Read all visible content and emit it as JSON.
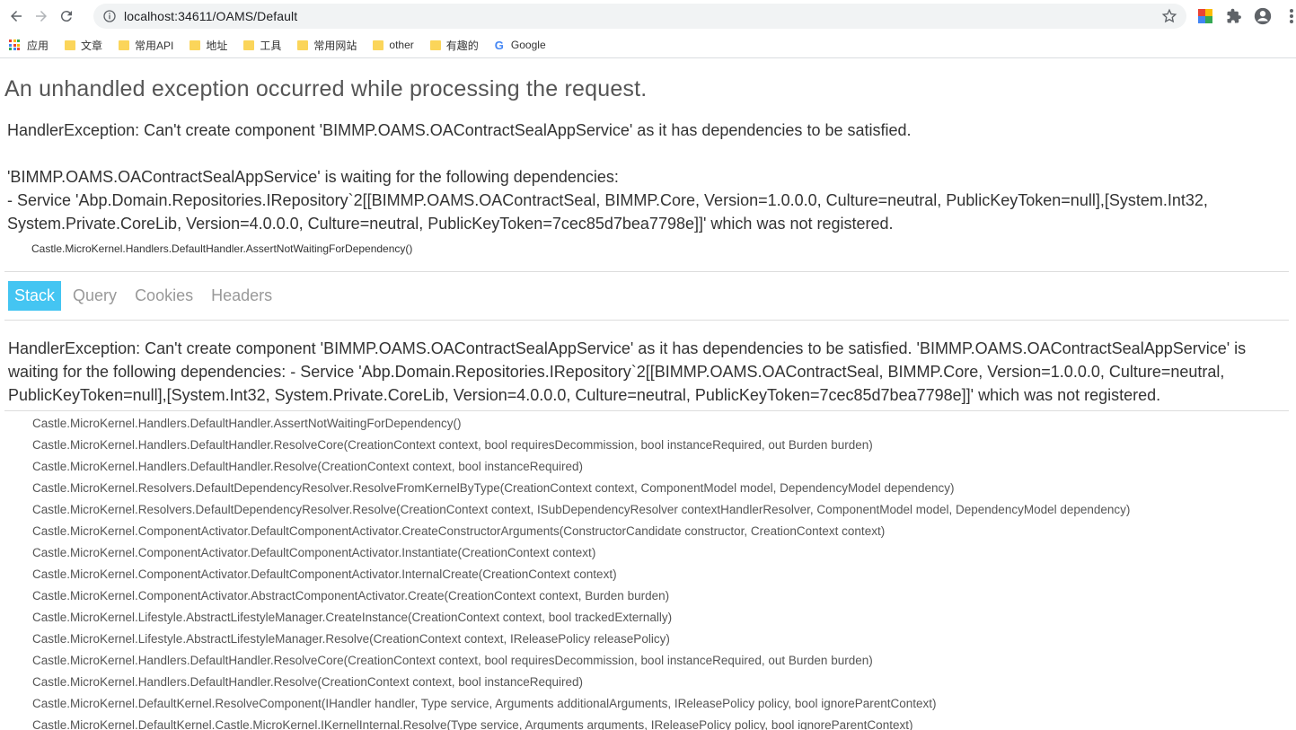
{
  "browser": {
    "url": "localhost:34611/OAMS/Default",
    "bookmarks": [
      {
        "label": "应用",
        "type": "apps"
      },
      {
        "label": "文章",
        "type": "folder"
      },
      {
        "label": "常用API",
        "type": "folder"
      },
      {
        "label": "地址",
        "type": "folder"
      },
      {
        "label": "工具",
        "type": "folder"
      },
      {
        "label": "常用网站",
        "type": "folder"
      },
      {
        "label": "other",
        "type": "folder"
      },
      {
        "label": "有趣的",
        "type": "folder"
      },
      {
        "label": "Google",
        "type": "google"
      }
    ]
  },
  "error": {
    "headline": "An unhandled exception occurred while processing the request.",
    "title_line1": "HandlerException: Can't create component 'BIMMP.OAMS.OAContractSealAppService' as it has dependencies to be satisfied.",
    "title_line2": "'BIMMP.OAMS.OAContractSealAppService' is waiting for the following dependencies:",
    "title_line3": "- Service 'Abp.Domain.Repositories.IRepository`2[[BIMMP.OAMS.OAContractSeal, BIMMP.Core, Version=1.0.0.0, Culture=neutral, PublicKeyToken=null],[System.Int32, System.Private.CoreLib, Version=4.0.0.0, Culture=neutral, PublicKeyToken=7cec85d7bea7798e]]' which was not registered.",
    "location": "Castle.MicroKernel.Handlers.DefaultHandler.AssertNotWaitingForDependency()"
  },
  "tabs": [
    "Stack",
    "Query",
    "Cookies",
    "Headers"
  ],
  "stack": {
    "title": "HandlerException: Can't create component 'BIMMP.OAMS.OAContractSealAppService' as it has dependencies to be satisfied. 'BIMMP.OAMS.OAContractSealAppService' is waiting for the following dependencies: - Service 'Abp.Domain.Repositories.IRepository`2[[BIMMP.OAMS.OAContractSeal, BIMMP.Core, Version=1.0.0.0, Culture=neutral, PublicKeyToken=null],[System.Int32, System.Private.CoreLib, Version=4.0.0.0, Culture=neutral, PublicKeyToken=7cec85d7bea7798e]]' which was not registered.",
    "frames": [
      "Castle.MicroKernel.Handlers.DefaultHandler.AssertNotWaitingForDependency()",
      "Castle.MicroKernel.Handlers.DefaultHandler.ResolveCore(CreationContext context, bool requiresDecommission, bool instanceRequired, out Burden burden)",
      "Castle.MicroKernel.Handlers.DefaultHandler.Resolve(CreationContext context, bool instanceRequired)",
      "Castle.MicroKernel.Resolvers.DefaultDependencyResolver.ResolveFromKernelByType(CreationContext context, ComponentModel model, DependencyModel dependency)",
      "Castle.MicroKernel.Resolvers.DefaultDependencyResolver.Resolve(CreationContext context, ISubDependencyResolver contextHandlerResolver, ComponentModel model, DependencyModel dependency)",
      "Castle.MicroKernel.ComponentActivator.DefaultComponentActivator.CreateConstructorArguments(ConstructorCandidate constructor, CreationContext context)",
      "Castle.MicroKernel.ComponentActivator.DefaultComponentActivator.Instantiate(CreationContext context)",
      "Castle.MicroKernel.ComponentActivator.DefaultComponentActivator.InternalCreate(CreationContext context)",
      "Castle.MicroKernel.ComponentActivator.AbstractComponentActivator.Create(CreationContext context, Burden burden)",
      "Castle.MicroKernel.Lifestyle.AbstractLifestyleManager.CreateInstance(CreationContext context, bool trackedExternally)",
      "Castle.MicroKernel.Lifestyle.AbstractLifestyleManager.Resolve(CreationContext context, IReleasePolicy releasePolicy)",
      "Castle.MicroKernel.Handlers.DefaultHandler.ResolveCore(CreationContext context, bool requiresDecommission, bool instanceRequired, out Burden burden)",
      "Castle.MicroKernel.Handlers.DefaultHandler.Resolve(CreationContext context, bool instanceRequired)",
      "Castle.MicroKernel.DefaultKernel.ResolveComponent(IHandler handler, Type service, Arguments additionalArguments, IReleasePolicy policy, bool ignoreParentContext)",
      "Castle.MicroKernel.DefaultKernel.Castle.MicroKernel.IKernelInternal.Resolve(Type service, Arguments arguments, IReleasePolicy policy, bool ignoreParentContext)"
    ]
  },
  "colors": {
    "active_tab": "#44c5f2",
    "folder": "#fbd55a"
  }
}
